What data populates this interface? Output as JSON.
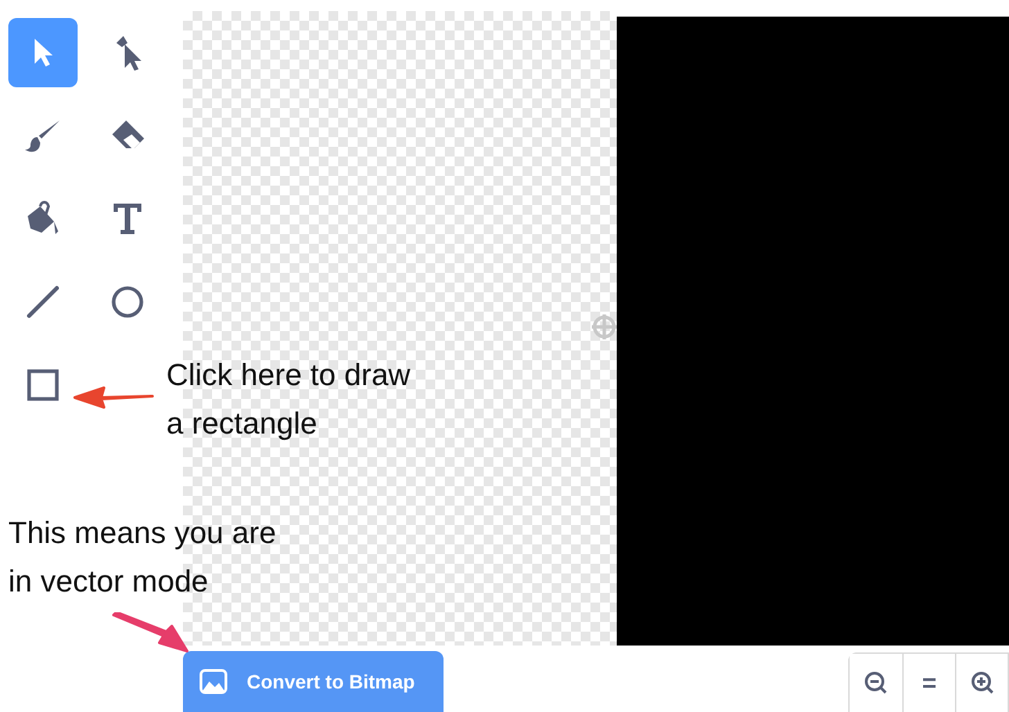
{
  "tools": [
    {
      "kind": "select",
      "selected": true
    },
    {
      "kind": "reshape",
      "selected": false
    },
    {
      "kind": "brush",
      "selected": false
    },
    {
      "kind": "eraser",
      "selected": false
    },
    {
      "kind": "fill",
      "selected": false
    },
    {
      "kind": "text",
      "selected": false
    },
    {
      "kind": "line",
      "selected": false
    },
    {
      "kind": "circle",
      "selected": false
    },
    {
      "kind": "rectangle",
      "selected": false
    }
  ],
  "annotations": [
    {
      "kind": "rectangle-hint",
      "lines": [
        "Click here to draw",
        "a rectangle"
      ]
    },
    {
      "kind": "mode-hint",
      "lines": [
        "This means you are",
        "in vector mode"
      ]
    }
  ],
  "convert_button": {
    "label": "Convert to Bitmap"
  },
  "zoom_controls": [
    {
      "kind": "zoom-out"
    },
    {
      "kind": "reset",
      "label": "="
    },
    {
      "kind": "zoom-in"
    }
  ]
}
